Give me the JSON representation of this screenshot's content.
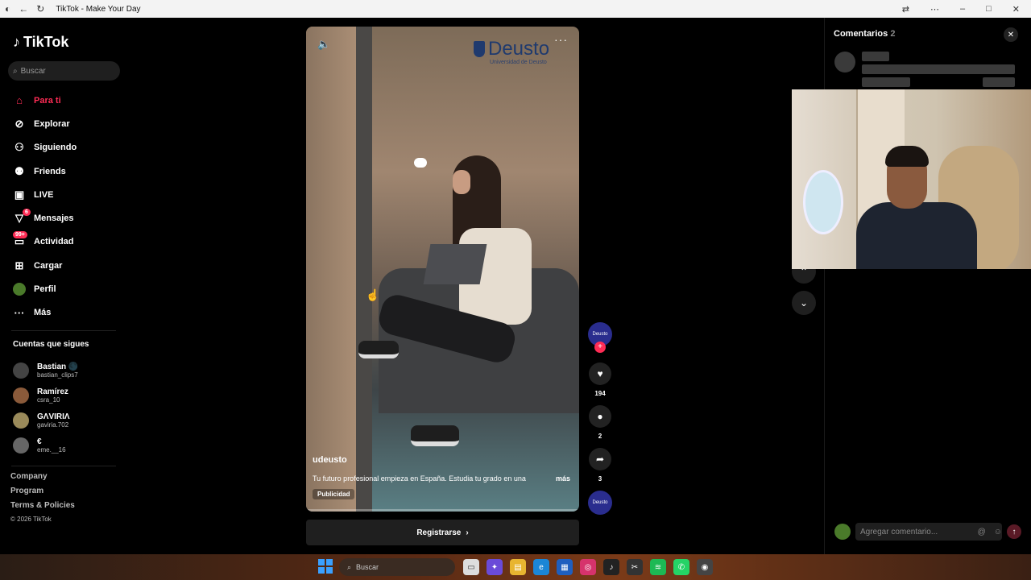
{
  "browser": {
    "title": "TikTok - Make Your Day",
    "nav_icons": [
      "back-icon",
      "reload-icon"
    ],
    "right_icons": [
      "translate-icon",
      "menu-icon",
      "minimize-icon",
      "maximize-icon",
      "close-icon"
    ]
  },
  "sidebar": {
    "logo": "TikTok",
    "search_placeholder": "Buscar",
    "items": [
      {
        "label": "Para ti",
        "icon": "home-icon",
        "active": true
      },
      {
        "label": "Explorar",
        "icon": "compass-icon"
      },
      {
        "label": "Siguiendo",
        "icon": "following-icon"
      },
      {
        "label": "Friends",
        "icon": "friends-icon"
      },
      {
        "label": "LIVE",
        "icon": "live-icon"
      },
      {
        "label": "Mensajes",
        "icon": "messages-icon",
        "badge": "6"
      },
      {
        "label": "Actividad",
        "icon": "activity-icon",
        "badge": "99+"
      },
      {
        "label": "Cargar",
        "icon": "upload-icon"
      },
      {
        "label": "Perfil",
        "icon": "profile-avatar"
      },
      {
        "label": "Más",
        "icon": "more-icon"
      }
    ],
    "following_title": "Cuentas que sigues",
    "following": [
      {
        "name": "Bastian 🌑",
        "handle": "bastian_clips7"
      },
      {
        "name": "Ramírez",
        "handle": "csra_10"
      },
      {
        "name": "GΛVIRIΛ",
        "handle": "gaviria.702"
      },
      {
        "name": "€",
        "handle": "eme.__16"
      }
    ],
    "footer": [
      "Company",
      "Program",
      "Terms & Policies"
    ],
    "copyright": "© 2026 TikTok"
  },
  "video": {
    "brand": "Deusto",
    "brand_sub": "Universidad de Deusto",
    "username": "udeusto",
    "description": "Tu futuro profesional empieza en España. Estudia tu grado en una",
    "more": "más",
    "tag": "Publicidad",
    "register": "Registrarse"
  },
  "actions": {
    "author_badge": "Deusto",
    "likes": "194",
    "comments": "2",
    "shares": "3"
  },
  "comments_panel": {
    "title": "Comentarios",
    "count": "2",
    "placeholder": "Agregar comentario..."
  },
  "taskbar": {
    "search_placeholder": "Buscar"
  },
  "colors": {
    "accent": "#fe2c55",
    "background": "#000000"
  }
}
